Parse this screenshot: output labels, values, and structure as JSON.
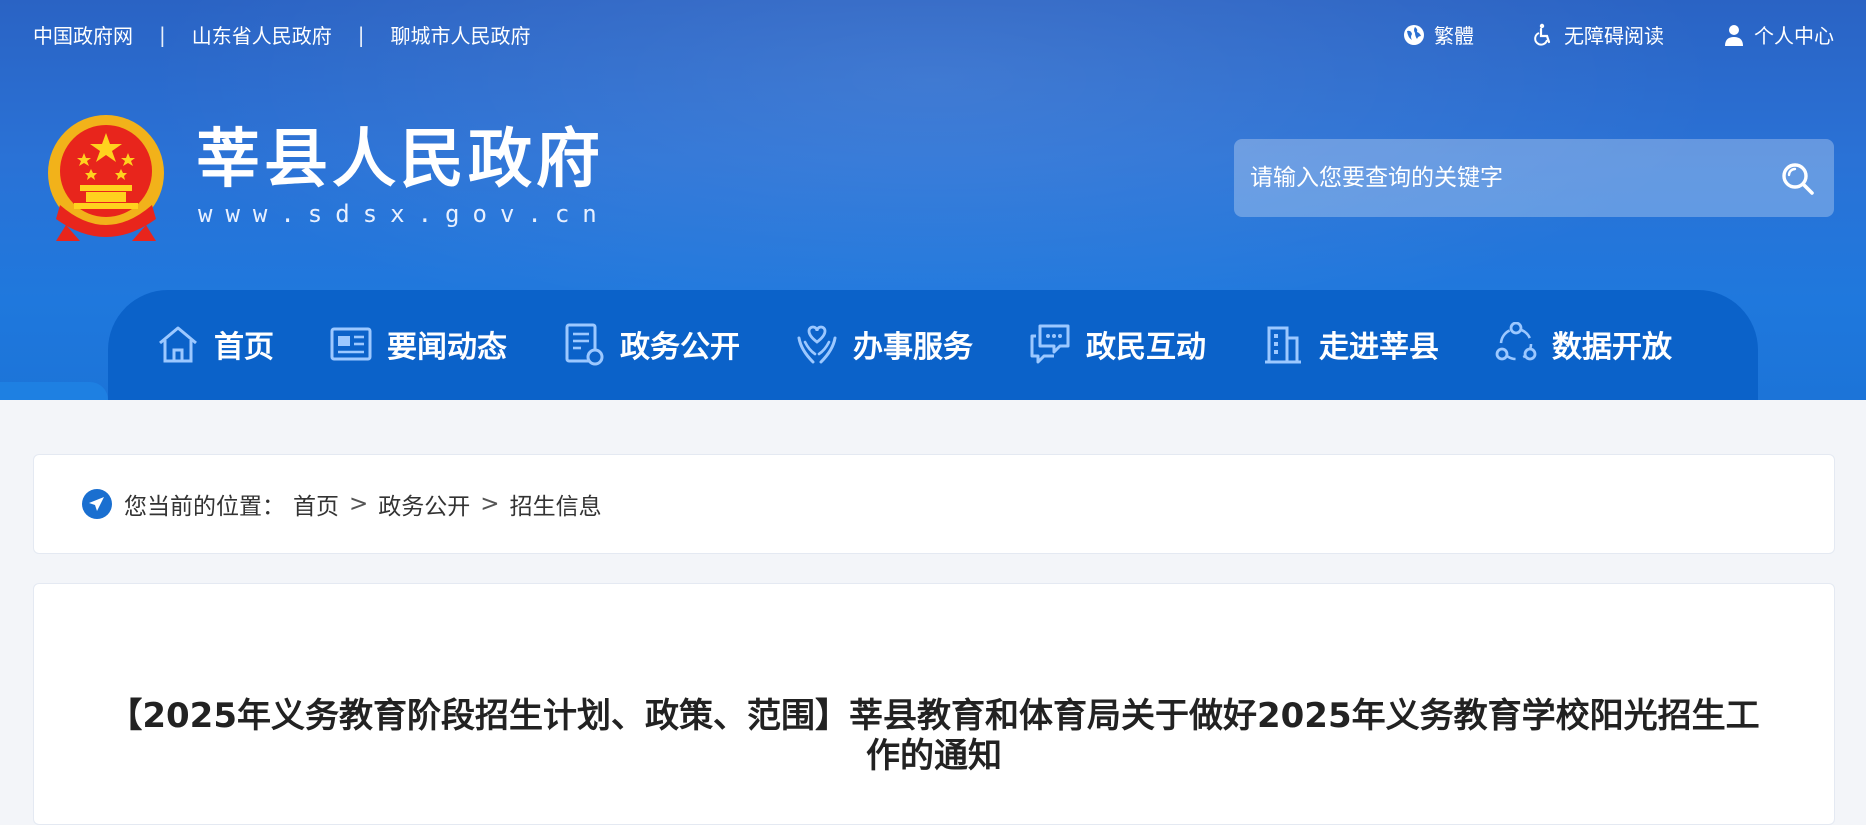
{
  "topbar": {
    "links": [
      "中国政府网",
      "山东省人民政府",
      "聊城市人民政府"
    ],
    "separator": "|",
    "right": {
      "traditional": "繁體",
      "accessibility": "无障碍阅读",
      "user_center": "个人中心"
    }
  },
  "site": {
    "title": "莘县人民政府",
    "url": "www.sdsx.gov.cn"
  },
  "search": {
    "placeholder": "请输入您要查询的关键字"
  },
  "nav": {
    "items": [
      {
        "label": "首页",
        "icon": "home-icon"
      },
      {
        "label": "要闻动态",
        "icon": "news-icon"
      },
      {
        "label": "政务公开",
        "icon": "document-icon"
      },
      {
        "label": "办事服务",
        "icon": "service-hands-icon"
      },
      {
        "label": "政民互动",
        "icon": "chat-icon"
      },
      {
        "label": "走进莘县",
        "icon": "building-icon"
      },
      {
        "label": "数据开放",
        "icon": "data-network-icon"
      }
    ]
  },
  "breadcrumb": {
    "prefix": "您当前的位置：",
    "items": [
      "首页",
      "政务公开",
      "招生信息"
    ],
    "separator": ">"
  },
  "article": {
    "title": "【2025年义务教育阶段招生计划、政策、范围】莘县教育和体育局关于做好2025年义务教育学校阳光招生工作的通知"
  },
  "colors": {
    "header_blue": "#2a6fd2",
    "nav_blue": "#0b62c9",
    "accent": "#1a6fd0"
  }
}
